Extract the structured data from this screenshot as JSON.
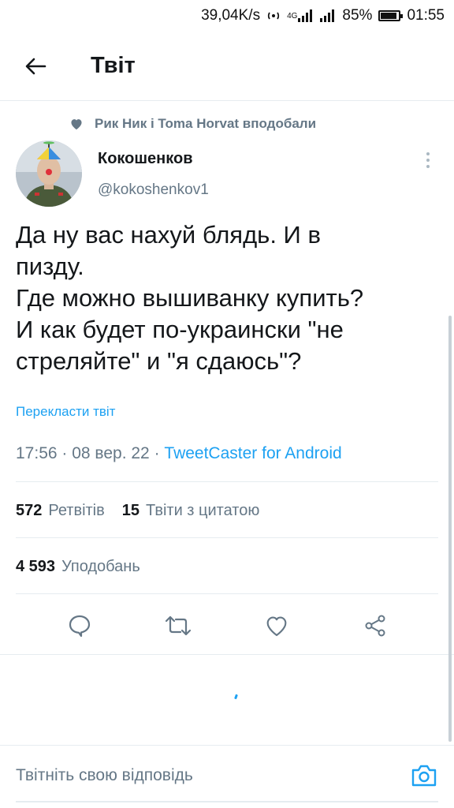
{
  "status_bar": {
    "net_speed": "39,04K/s",
    "network": "4G",
    "battery": "85%",
    "time": "01:55"
  },
  "header": {
    "title": "Твіт"
  },
  "social_context": {
    "text": "Рик Ник і Toma Horvat вподобали"
  },
  "author": {
    "name": "Кокошенков",
    "handle": "@kokoshenkov1"
  },
  "tweet": {
    "text": "Да ну вас нахуй блядь. И в\nпизду.\nГде можно вышиванку купить?\nИ как будет по-украински \"не\nстреляйте\" и \"я сдаюсь\"?",
    "translate_label": "Перекласти твіт",
    "time": "17:56",
    "date": "08 вер. 22",
    "source": "TweetCaster for Android"
  },
  "stats": {
    "retweets_count": "572",
    "retweets_label": "Ретвітів",
    "quotes_count": "15",
    "quotes_label": "Твіти з цитатою",
    "likes_count": "4 593",
    "likes_label": "Уподобань"
  },
  "reply": {
    "placeholder": "Твітніть свою відповідь"
  },
  "colors": {
    "accent": "#1da1f2",
    "secondary_text": "#657786",
    "divider": "#e6ecf0"
  }
}
